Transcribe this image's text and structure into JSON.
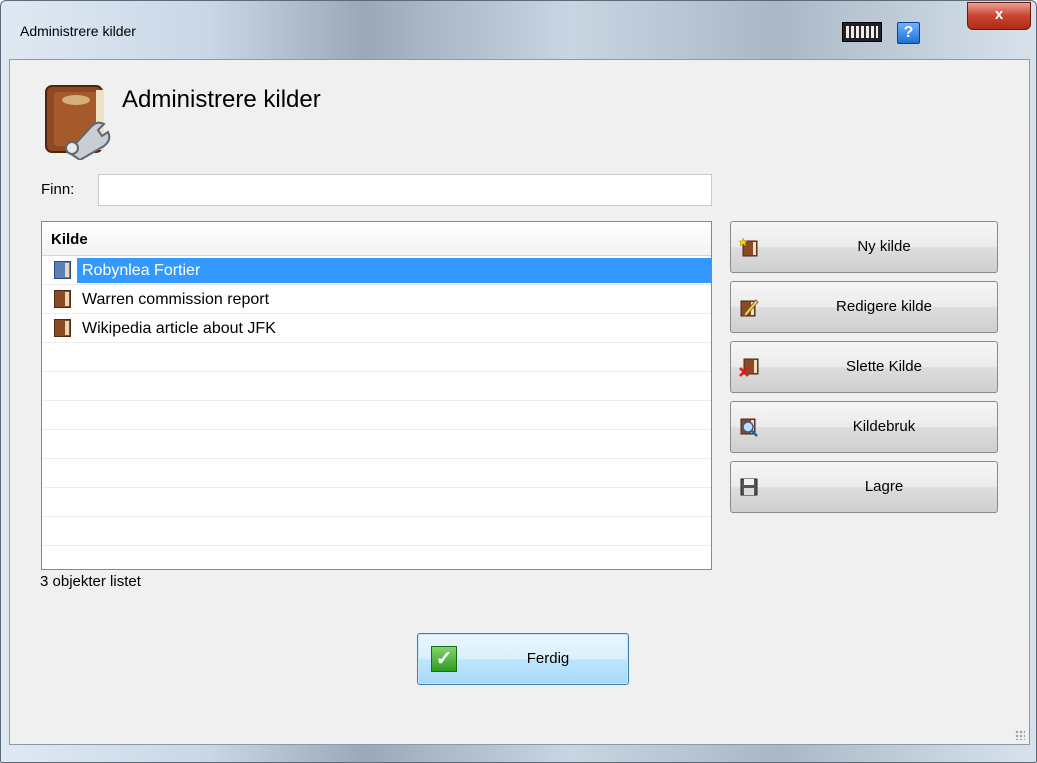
{
  "window": {
    "title": "Administrere kilder",
    "close_label": "x",
    "help_label": "?"
  },
  "header": {
    "title": "Administrere kilder"
  },
  "search": {
    "label": "Finn:",
    "value": "",
    "placeholder": ""
  },
  "list": {
    "column_header": "Kilde",
    "items": [
      {
        "label": "Robynlea Fortier",
        "selected": true
      },
      {
        "label": "Warren commission report",
        "selected": false
      },
      {
        "label": "Wikipedia article about JFK",
        "selected": false
      }
    ],
    "status": "3 objekter listet"
  },
  "actions": {
    "new_label": "Ny kilde",
    "edit_label": "Redigere kilde",
    "delete_label": "Slette Kilde",
    "usage_label": "Kildebruk",
    "save_label": "Lagre"
  },
  "footer": {
    "done_label": "Ferdig"
  },
  "colors": {
    "selection": "#3399ff",
    "close_button": "#c9442f",
    "done_accent": "#2f9a1f"
  },
  "icons": {
    "new": "new-source-icon",
    "edit": "edit-source-icon",
    "delete": "delete-source-icon",
    "usage": "source-usage-icon",
    "save": "save-icon",
    "done": "check-icon"
  }
}
